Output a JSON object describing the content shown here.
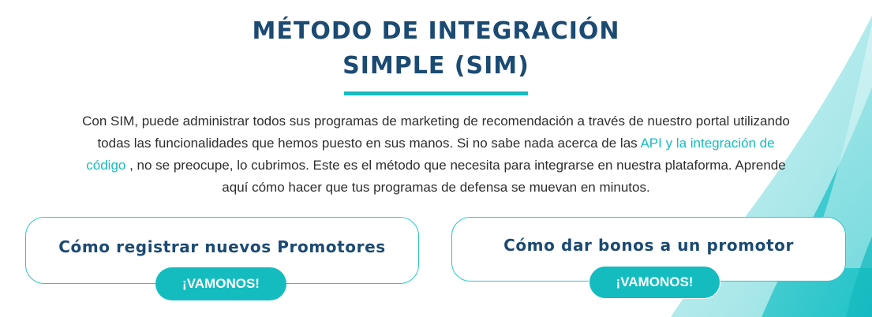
{
  "header": {
    "title_line1": "MÉTODO DE INTEGRACIÓN",
    "title_line2": "SIMPLE (SIM)"
  },
  "description": {
    "text_before_link": "Con SIM, puede administrar todos sus programas de marketing de recomendación a través de nuestro portal utilizando todas las funcionalidades que hemos puesto en sus manos. Si no sabe nada acerca de las ",
    "link_text": "API y la integración de código",
    "text_after_link": " , no se preocupe, lo cubrimos. Este es el método que necesita para integrarse en nuestra plataforma. Aprende aquí cómo hacer que tus programas de defensa se muevan en minutos."
  },
  "cards": [
    {
      "title": "Cómo registrar nuevos Promotores",
      "button_label": "¡VAMONOS!"
    },
    {
      "title": "Cómo dar bonos a un promotor",
      "button_label": "¡VAMONOS!"
    }
  ],
  "colors": {
    "title": "#1b4a72",
    "accent": "#14bcc0",
    "text": "#2e2e2e",
    "background": "#ffffff"
  }
}
